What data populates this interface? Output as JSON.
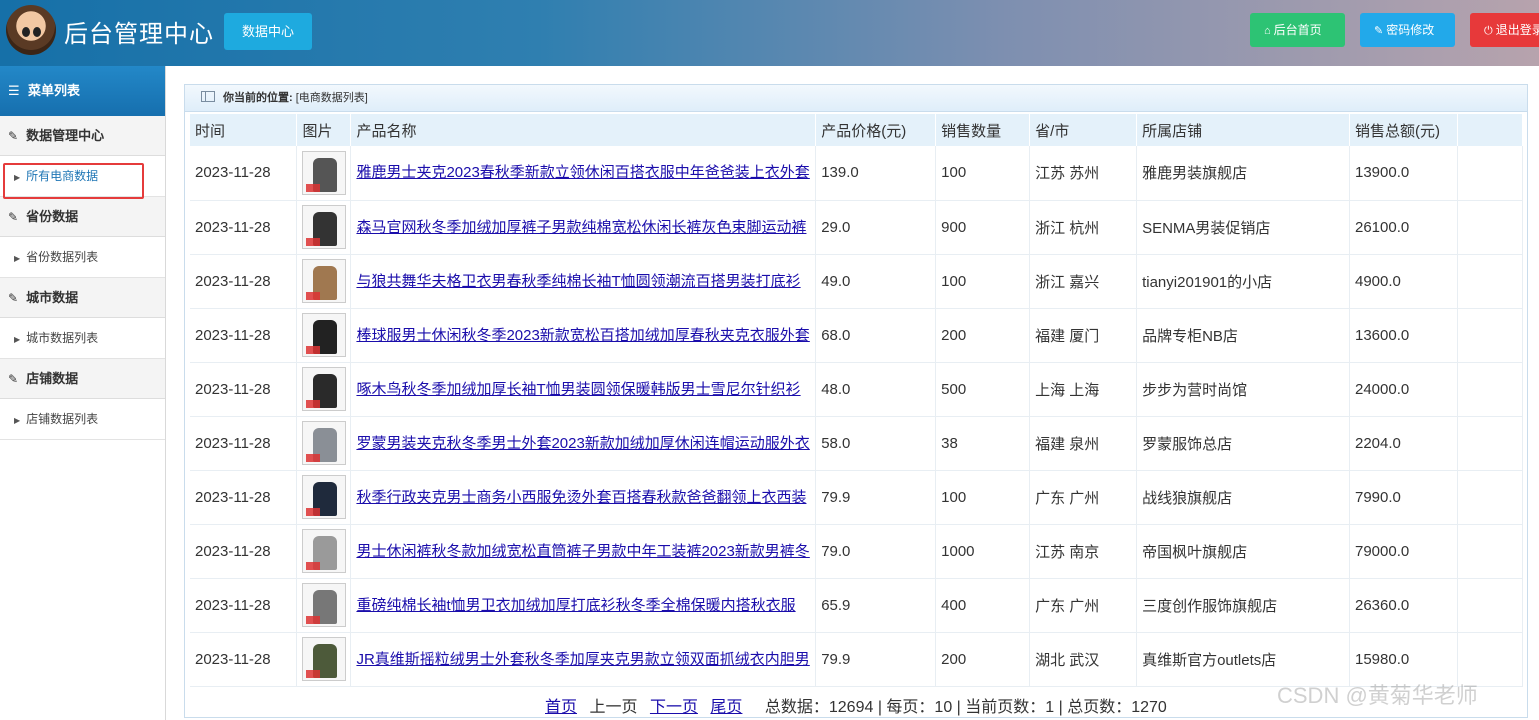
{
  "header": {
    "title": "后台管理中心",
    "data_center": "数据中心",
    "home_btn": "后台首页",
    "pwd_btn": "密码修改",
    "exit_btn": "退出登录"
  },
  "sidebar": {
    "title": "菜单列表",
    "groups": [
      {
        "label": "数据管理中心",
        "items": [
          "所有电商数据"
        ]
      },
      {
        "label": "省份数据",
        "items": [
          "省份数据列表"
        ]
      },
      {
        "label": "城市数据",
        "items": [
          "城市数据列表"
        ]
      },
      {
        "label": "店铺数据",
        "items": [
          "店铺数据列表"
        ]
      }
    ],
    "active_item": "所有电商数据"
  },
  "breadcrumb": {
    "prefix": "你当前的位置:",
    "path": "[电商数据列表]"
  },
  "table": {
    "headers": [
      "时间",
      "图片",
      "产品名称",
      "产品价格(元)",
      "销售数量",
      "省/市",
      "所属店铺",
      "销售总额(元)"
    ],
    "rows": [
      {
        "date": "2023-11-28",
        "name": "雅鹿男士夹克2023春秋季新款立领休闲百搭衣服中年爸爸装上衣外套",
        "price": "139.0",
        "qty": "100",
        "region": "江苏 苏州",
        "shop": "雅鹿男装旗舰店",
        "total": "13900.0",
        "img_color": "#555"
      },
      {
        "date": "2023-11-28",
        "name": "森马官网秋冬季加绒加厚裤子男款纯棉宽松休闲长裤灰色束脚运动裤",
        "price": "29.0",
        "qty": "900",
        "region": "浙江 杭州",
        "shop": "SENMA男装促销店",
        "total": "26100.0",
        "img_color": "#333"
      },
      {
        "date": "2023-11-28",
        "name": "与狼共舞华夫格卫衣男春秋季纯棉长袖T恤圆领潮流百搭男装打底衫",
        "price": "49.0",
        "qty": "100",
        "region": "浙江 嘉兴",
        "shop": "tianyi201901的小店",
        "total": "4900.0",
        "img_color": "#a07850"
      },
      {
        "date": "2023-11-28",
        "name": "棒球服男士休闲秋冬季2023新款宽松百搭加绒加厚春秋夹克衣服外套",
        "price": "68.0",
        "qty": "200",
        "region": "福建 厦门",
        "shop": "品牌专柜NB店",
        "total": "13600.0",
        "img_color": "#222"
      },
      {
        "date": "2023-11-28",
        "name": "啄木鸟秋冬季加绒加厚长袖T恤男装圆领保暖韩版男士雪尼尔针织衫",
        "price": "48.0",
        "qty": "500",
        "region": "上海 上海",
        "shop": "步步为营时尚馆",
        "total": "24000.0",
        "img_color": "#2a2a2a"
      },
      {
        "date": "2023-11-28",
        "name": "罗蒙男装夹克秋冬季男士外套2023新款加绒加厚休闲连帽运动服外衣",
        "price": "58.0",
        "qty": "38",
        "region": "福建 泉州",
        "shop": "罗蒙服饰总店",
        "total": "2204.0",
        "img_color": "#8a8f96"
      },
      {
        "date": "2023-11-28",
        "name": "秋季行政夹克男士商务小西服免烫外套百搭春秋款爸爸翻领上衣西装",
        "price": "79.9",
        "qty": "100",
        "region": "广东 广州",
        "shop": "战线狼旗舰店",
        "total": "7990.0",
        "img_color": "#1f2a3c"
      },
      {
        "date": "2023-11-28",
        "name": "男士休闲裤秋冬款加绒宽松直筒裤子男款中年工装裤2023新款男裤冬",
        "price": "79.0",
        "qty": "1000",
        "region": "江苏 南京",
        "shop": "帝国枫叶旗舰店",
        "total": "79000.0",
        "img_color": "#9a9a9a"
      },
      {
        "date": "2023-11-28",
        "name": "重磅纯棉长袖t恤男卫衣加绒加厚打底衫秋冬季全棉保暖内搭秋衣服",
        "price": "65.9",
        "qty": "400",
        "region": "广东 广州",
        "shop": "三度创作服饰旗舰店",
        "total": "26360.0",
        "img_color": "#777"
      },
      {
        "date": "2023-11-28",
        "name": "JR真维斯摇粒绒男士外套秋冬季加厚夹克男款立领双面抓绒衣内胆男",
        "price": "79.9",
        "qty": "200",
        "region": "湖北 武汉",
        "shop": "真维斯官方outlets店",
        "total": "15980.0",
        "img_color": "#4d5a3a"
      }
    ]
  },
  "pager": {
    "first": "首页",
    "prev": "上一页",
    "next": "下一页",
    "last": "尾页",
    "stats": "总数据：12694 | 每页：10 | 当前页数：1 | 总页数：1270"
  },
  "watermark": "CSDN @黄菊华老师"
}
